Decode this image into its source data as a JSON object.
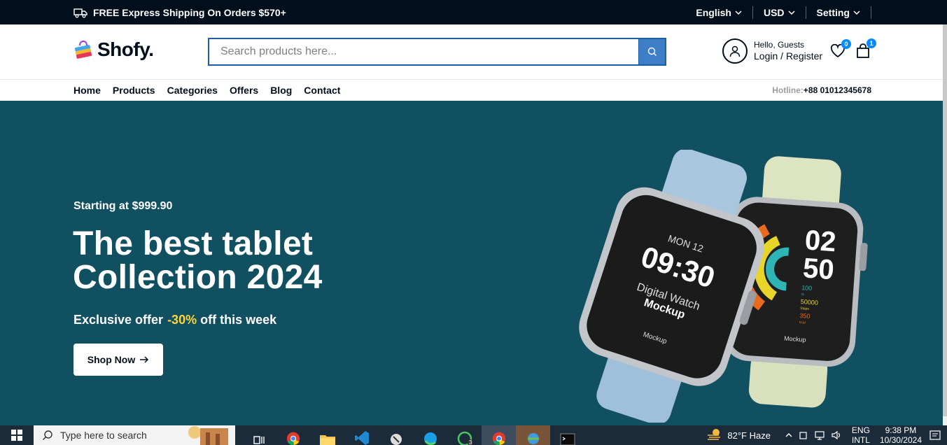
{
  "topbar": {
    "shipping_text": "FREE Express Shipping On Orders $570+",
    "language": "English",
    "currency": "USD",
    "setting": "Setting"
  },
  "header": {
    "logo_text": "Shofy.",
    "search_placeholder": "Search products here...",
    "hello": "Hello, Guests",
    "login": "Login",
    "separator": "/",
    "register": "Register",
    "wishlist_count": "0",
    "cart_count": "1"
  },
  "nav": {
    "items": [
      "Home",
      "Products",
      "Categories",
      "Offers",
      "Blog",
      "Contact"
    ],
    "hotline_label": "Hotline:",
    "hotline_number": "+88 01012345678"
  },
  "hero": {
    "starting": "Starting at $999.90",
    "title_line1": "The best tablet",
    "title_line2": "Collection 2024",
    "offer_prefix": "Exclusive offer",
    "offer_percent": "-30%",
    "offer_suffix": "off this week",
    "button_label": "Shop Now",
    "watch1": {
      "day": "MON 12",
      "time": "09:30",
      "label1": "Digital Watch",
      "label2": "Mockup",
      "brand": "Mockup"
    },
    "watch2": {
      "hour": "02",
      "minute": "50",
      "stat1": "100",
      "stat1_unit": "%",
      "stat2": "50000",
      "stat2_unit": "Steps",
      "stat3": "350",
      "stat3_unit": "kcal",
      "brand": "Mockup"
    },
    "background_color": "#115061",
    "accent_color": "#ffd43a"
  },
  "taskbar": {
    "search_placeholder": "Type here to search",
    "weather": "82°F  Haze",
    "lang_line1": "ENG",
    "lang_line2": "INTL",
    "time": "9:38 PM",
    "date": "10/30/2024",
    "whatsapp_badge": "3"
  }
}
